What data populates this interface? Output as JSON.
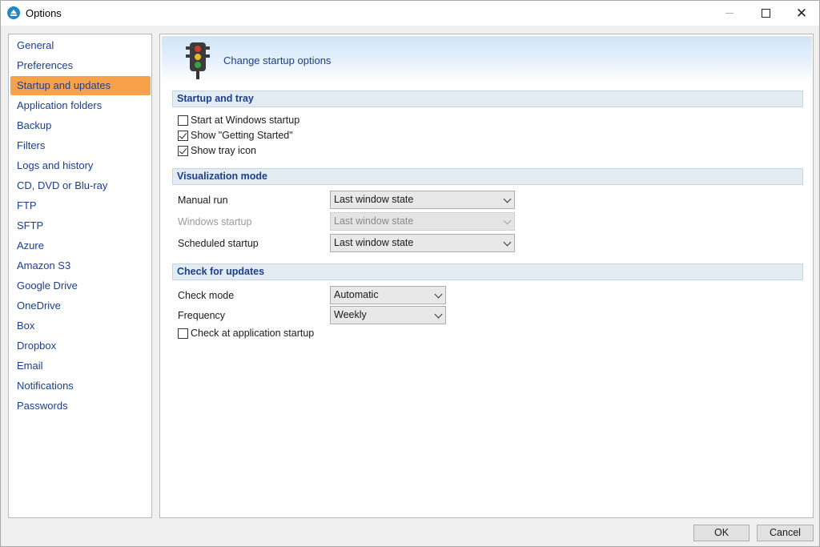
{
  "window": {
    "title": "Options"
  },
  "sidebar": {
    "items": [
      {
        "label": "General"
      },
      {
        "label": "Preferences"
      },
      {
        "label": "Startup and updates"
      },
      {
        "label": "Application folders"
      },
      {
        "label": "Backup"
      },
      {
        "label": "Filters"
      },
      {
        "label": "Logs and history"
      },
      {
        "label": "CD, DVD or Blu-ray"
      },
      {
        "label": "FTP"
      },
      {
        "label": "SFTP"
      },
      {
        "label": "Azure"
      },
      {
        "label": "Amazon S3"
      },
      {
        "label": "Google Drive"
      },
      {
        "label": "OneDrive"
      },
      {
        "label": "Box"
      },
      {
        "label": "Dropbox"
      },
      {
        "label": "Email"
      },
      {
        "label": "Notifications"
      },
      {
        "label": "Passwords"
      }
    ],
    "selected_label": "Startup and updates"
  },
  "banner": {
    "icon": "traffic-light-icon",
    "text": "Change startup options"
  },
  "startup_and_tray": {
    "header": "Startup and tray",
    "start_at_windows_startup": {
      "label": "Start at Windows startup",
      "checked": false
    },
    "show_getting_started": {
      "label": "Show \"Getting Started\"",
      "checked": true
    },
    "show_tray_icon": {
      "label": "Show tray icon",
      "checked": true
    }
  },
  "visualization_mode": {
    "header": "Visualization mode",
    "manual_run": {
      "label": "Manual run",
      "value": "Last window state"
    },
    "windows_startup": {
      "label": "Windows startup",
      "value": "Last window state",
      "disabled": true
    },
    "scheduled_startup": {
      "label": "Scheduled startup",
      "value": "Last window state"
    }
  },
  "check_for_updates": {
    "header": "Check for updates",
    "check_mode": {
      "label": "Check mode",
      "value": "Automatic"
    },
    "frequency": {
      "label": "Frequency",
      "value": "Weekly"
    },
    "check_at_startup": {
      "label": "Check at application startup",
      "checked": false
    }
  },
  "buttons": {
    "ok": "OK",
    "cancel": "Cancel"
  },
  "colors": {
    "selected_item": "#f7a24a",
    "link_text": "#1b3f8c",
    "section_header_bg": "#e3ebf3"
  }
}
